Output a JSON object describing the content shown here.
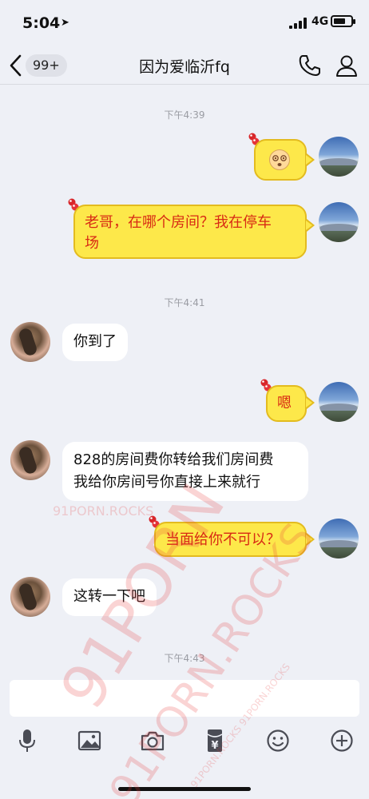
{
  "status_bar": {
    "time": "5:04",
    "network": "4G"
  },
  "nav": {
    "unread_badge": "99+",
    "title": "因为爱临沂fq"
  },
  "timestamps": [
    "下午4:39",
    "下午4:41",
    "下午4:43"
  ],
  "messages": [
    {
      "sender": "me",
      "text": ""
    },
    {
      "sender": "me",
      "text": "老哥，在哪个房间？我在停车场"
    },
    {
      "sender": "other",
      "text": "你到了"
    },
    {
      "sender": "me",
      "text": "嗯"
    },
    {
      "sender": "other",
      "text": "828的房间费你转给我们房间费我给你房间号你直接上来就行"
    },
    {
      "sender": "me",
      "text": "当面给你不可以？"
    },
    {
      "sender": "other",
      "text": "这转一下吧"
    }
  ],
  "message_lines": {
    "m1_line1": "老哥，在哪个房间？我在停车",
    "m1_line2": "场",
    "m4_line1": "828的房间费你转给我们房间费",
    "m4_line2": "我给你房间号你直接上来就行"
  },
  "toolbar": {
    "icons": [
      "microphone-icon",
      "image-icon",
      "camera-icon",
      "red-packet-icon",
      "emoji-icon",
      "plus-icon"
    ],
    "red_packet_symbol": "¥"
  },
  "watermarks": [
    "91PORN",
    "91PORN.ROCKS",
    "91PORN.ROCKS",
    "91PORN.ROCKS 91PORN.ROCKS"
  ],
  "colors": {
    "background": "#eef0f6",
    "bubble_out": "#fde84a",
    "bubble_out_text": "#d82a14",
    "bubble_in": "#ffffff"
  }
}
